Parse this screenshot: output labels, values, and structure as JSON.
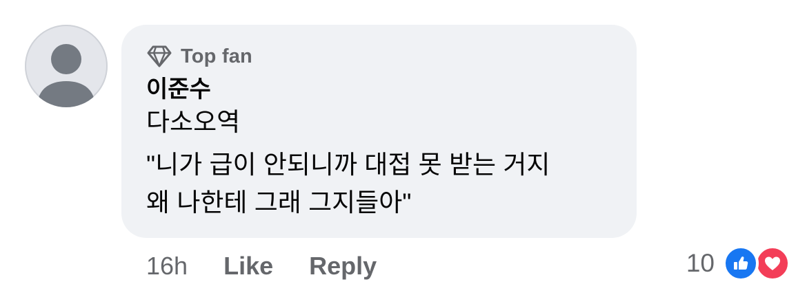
{
  "comment": {
    "badge": {
      "icon": "diamond-icon",
      "label": "Top fan"
    },
    "author": "이준수",
    "lines": [
      "다소오역",
      "\"니가 급이 안되니까 대접 못 받는 거지",
      "왜 나한테 그래 그지들아\""
    ]
  },
  "actions": {
    "timestamp": "16h",
    "like_label": "Like",
    "reply_label": "Reply"
  },
  "reactions": {
    "count": "10",
    "types": [
      "like-icon",
      "love-icon"
    ]
  },
  "colors": {
    "bubble": "#f0f2f5",
    "secondary_text": "#65676b",
    "like_blue": "#1877f2",
    "love_red": "#f33e58"
  }
}
